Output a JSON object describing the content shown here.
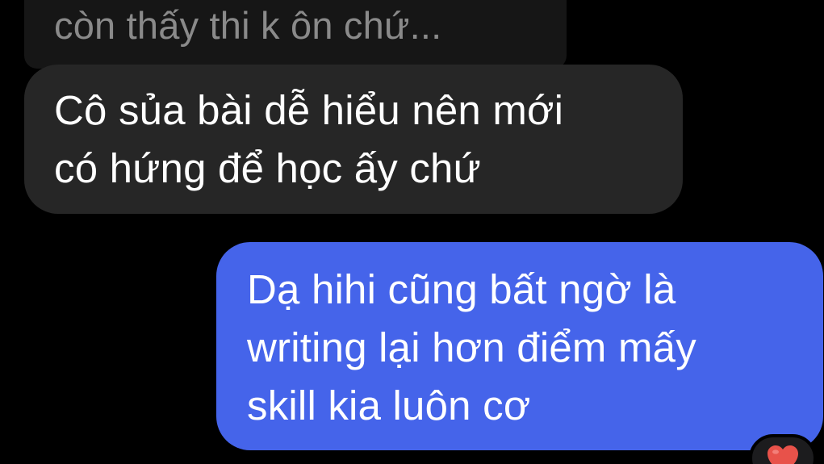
{
  "messages": [
    {
      "role": "quoted-reply",
      "lines": [
        "còn thấy thi k ôn chứ..."
      ]
    },
    {
      "role": "received",
      "lines": [
        "Cô sủa bài dễ hiểu nên mới",
        "có hứng để học ấy chứ"
      ]
    },
    {
      "role": "sent",
      "lines": [
        "Dạ hihi cũng bất ngờ là",
        "writing lại hơn điểm mấy",
        "skill kia luôn cơ"
      ]
    }
  ],
  "reaction": {
    "icon": "heart-icon",
    "color": "#e8524a"
  },
  "colors": {
    "background": "#000000",
    "received_bubble": "#262626",
    "sent_bubble": "#4564ea",
    "quoted_bubble": "#161616"
  }
}
